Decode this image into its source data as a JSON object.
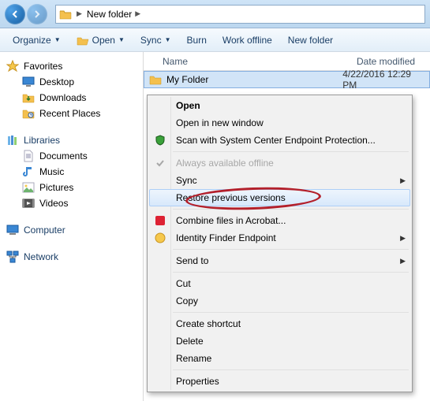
{
  "title": {
    "location": "New folder"
  },
  "toolbar": {
    "organize": "Organize",
    "open": "Open",
    "sync": "Sync",
    "burn": "Burn",
    "work_offline": "Work offline",
    "new_folder": "New folder"
  },
  "sidebar": {
    "favorites": {
      "label": "Favorites",
      "items": [
        "Desktop",
        "Downloads",
        "Recent Places"
      ]
    },
    "libraries": {
      "label": "Libraries",
      "items": [
        "Documents",
        "Music",
        "Pictures",
        "Videos"
      ]
    },
    "computer": {
      "label": "Computer"
    },
    "network": {
      "label": "Network"
    }
  },
  "columns": {
    "name": "Name",
    "date": "Date modified"
  },
  "rows": [
    {
      "name": "My Folder",
      "date": "4/22/2016 12:29 PM"
    }
  ],
  "context_menu": {
    "open": "Open",
    "open_new": "Open in new window",
    "scan": "Scan with System Center Endpoint Protection...",
    "always_offline": "Always available offline",
    "sync": "Sync",
    "restore": "Restore previous versions",
    "acrobat": "Combine files in Acrobat...",
    "identity": "Identity Finder Endpoint",
    "send_to": "Send to",
    "cut": "Cut",
    "copy": "Copy",
    "shortcut": "Create shortcut",
    "delete": "Delete",
    "rename": "Rename",
    "properties": "Properties"
  }
}
